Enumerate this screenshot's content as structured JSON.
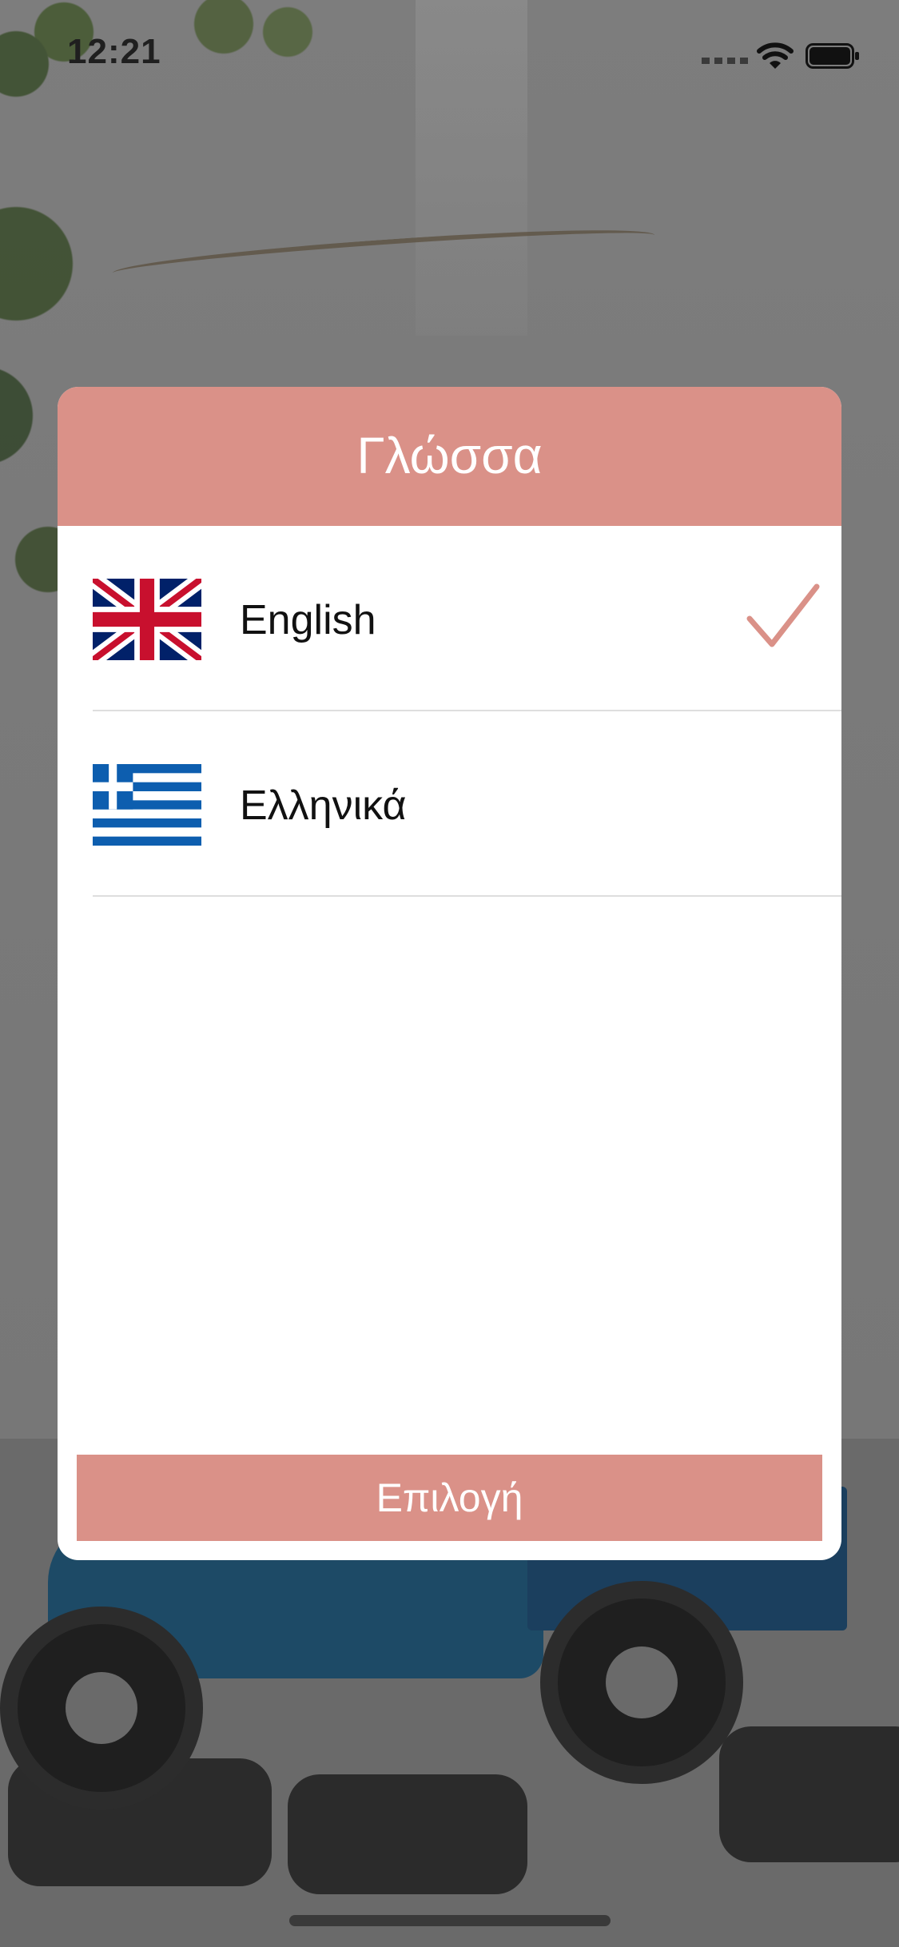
{
  "status_bar": {
    "time": "12:21",
    "icons": [
      "signal-icon",
      "wifi-icon",
      "battery-icon"
    ]
  },
  "dialog": {
    "title": "Γλώσσα",
    "languages": [
      {
        "label": "English",
        "flag": "uk-flag-icon",
        "selected": true
      },
      {
        "label": "Ελληνικά",
        "flag": "greece-flag-icon",
        "selected": false
      }
    ],
    "select_button_label": "Επιλογή"
  },
  "colors": {
    "accent": "#da9188",
    "header_text": "#ffffff",
    "check": "#da9188"
  }
}
